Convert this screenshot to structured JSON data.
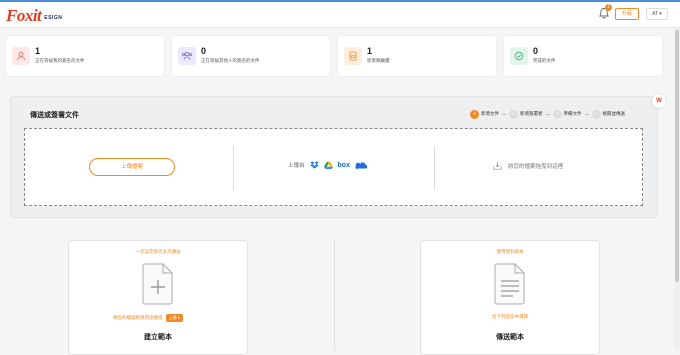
{
  "header": {
    "logo_text": "Foxit",
    "logo_sub": "ESIGN",
    "notification_count": "1",
    "upgrade_label": "升級",
    "user_label": "AT ▾"
  },
  "stats": [
    {
      "count": "1",
      "label": "正在等候我的簽名的文件",
      "color": "#f26d6d"
    },
    {
      "count": "0",
      "label": "正在等候其他人的簽名的文件",
      "color": "#7c6cd8"
    },
    {
      "count": "1",
      "label": "從草稿繼續",
      "color": "#f08a24"
    },
    {
      "count": "0",
      "label": "完成的文件",
      "color": "#3bb273"
    }
  ],
  "send_panel": {
    "title": "傳送或簽署文件",
    "steps": [
      {
        "num": "1",
        "label": "新增文件"
      },
      {
        "num": "2",
        "label": "新增簽署者"
      },
      {
        "num": "3",
        "label": "準備文件"
      },
      {
        "num": "4",
        "label": "檢閱並傳送"
      }
    ],
    "upload_button": "上傳檔案",
    "upload_from": "上傳自",
    "box_label": "box",
    "drag_text": "將您的檔案拖曳到這裡"
  },
  "templates": {
    "create": {
      "top": "一次設定即可多次傳送",
      "hint": "將您的檔案拖曳到這裡或",
      "badge": "上傳 ▾",
      "title": "建立範本"
    },
    "send": {
      "top": "使用現有範本",
      "hint": "從下列區段中選擇",
      "title": "傳送範本"
    }
  },
  "colors": {
    "accent": "#f08a24",
    "brand": "#e23b1e"
  }
}
